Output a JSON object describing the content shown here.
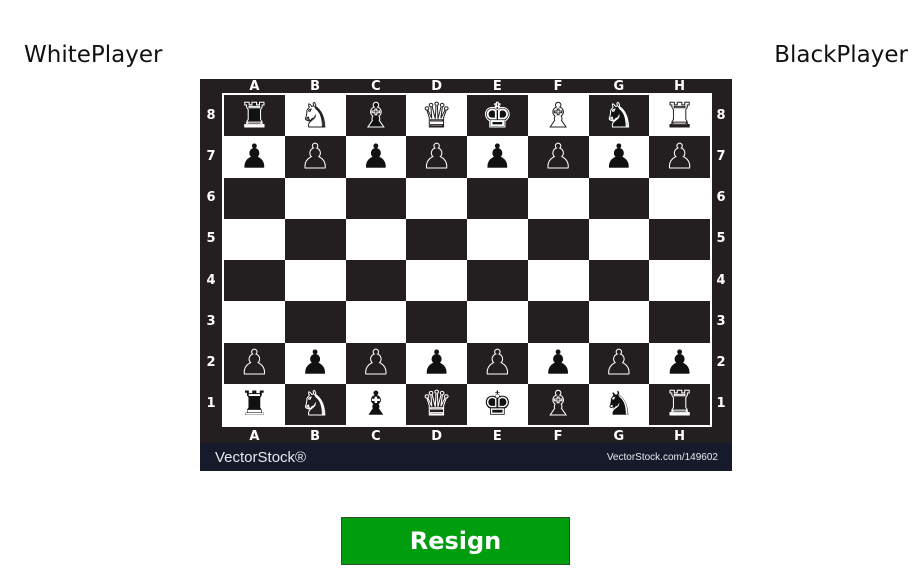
{
  "players": {
    "white": "WhitePlayer",
    "black": "BlackPlayer"
  },
  "board": {
    "files": [
      "A",
      "B",
      "C",
      "D",
      "E",
      "F",
      "G",
      "H"
    ],
    "ranks": [
      "8",
      "7",
      "6",
      "5",
      "4",
      "3",
      "2",
      "1"
    ],
    "position": [
      [
        "bR",
        "wN",
        "bB",
        "wQ",
        "bK",
        "wB",
        "bN",
        "wR"
      ],
      [
        "bP",
        "wP",
        "bP",
        "wP",
        "bP",
        "wP",
        "bP",
        "wP"
      ],
      [
        "",
        "",
        "",
        "",
        "",
        "",
        "",
        ""
      ],
      [
        "",
        "",
        "",
        "",
        "",
        "",
        "",
        ""
      ],
      [
        "",
        "",
        "",
        "",
        "",
        "",
        "",
        ""
      ],
      [
        "",
        "",
        "",
        "",
        "",
        "",
        "",
        ""
      ],
      [
        "wP",
        "bP",
        "wP",
        "bP",
        "wP",
        "bP",
        "wP",
        "bP"
      ],
      [
        "bR",
        "wN",
        "bB",
        "wQ",
        "bK",
        "wB",
        "bN",
        "wR"
      ]
    ],
    "watermark_brand": "VectorStock®",
    "watermark_url": "VectorStock.com/149602"
  },
  "actions": {
    "resign_label": "Resign"
  },
  "colors": {
    "resign_button": "#009e0f",
    "board_dark": "#231f20",
    "board_light": "#ffffff",
    "footer": "#171a2b"
  }
}
